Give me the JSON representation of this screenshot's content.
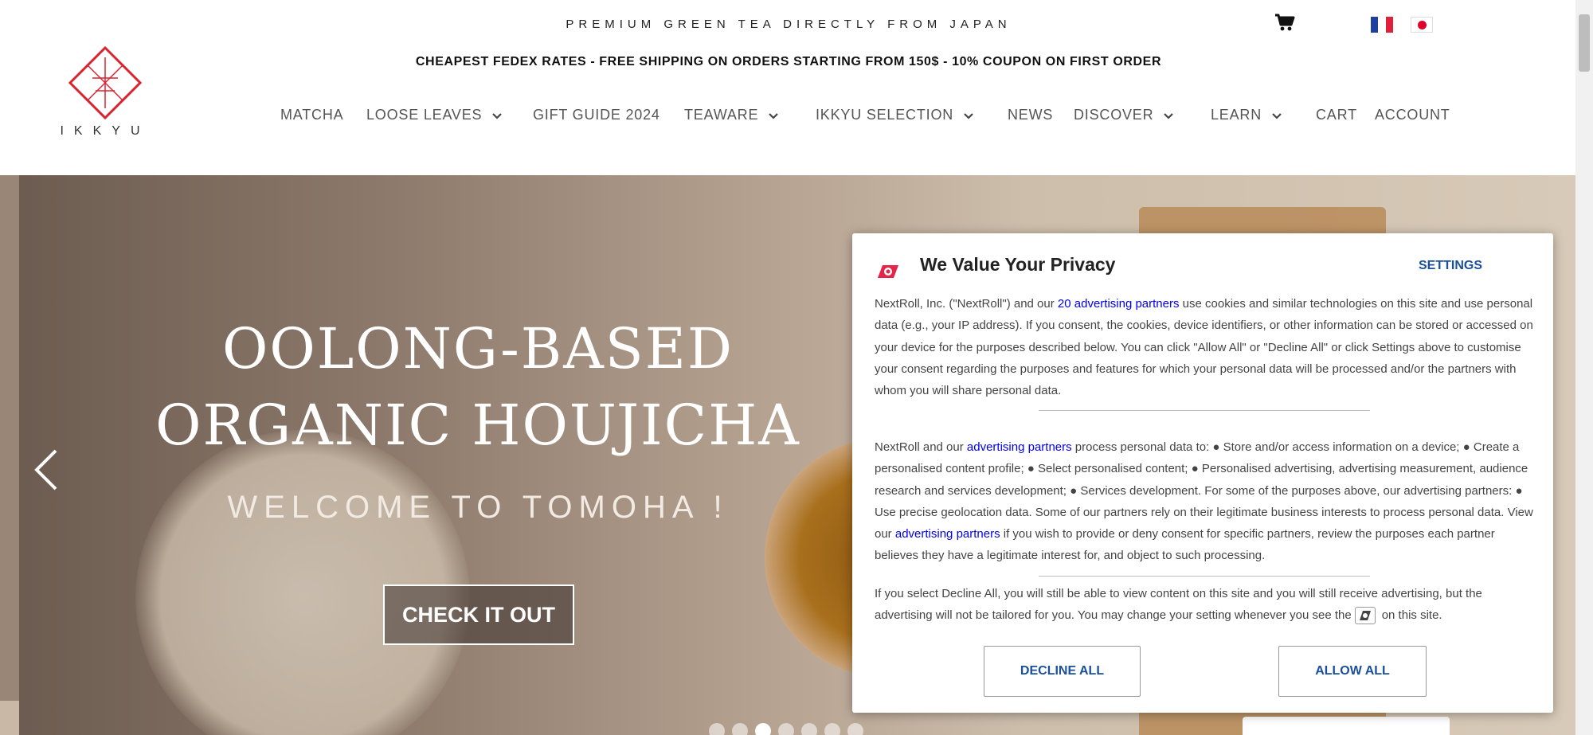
{
  "header": {
    "tagline": "PREMIUM GREEN TEA DIRECTLY FROM JAPAN",
    "shipping_banner": "CHEAPEST FEDEX RATES - FREE SHIPPING ON ORDERS STARTING FROM 150$ - 10% COUPON ON FIRST ORDER",
    "logo_text": "IKKYU",
    "icons": {
      "cart": "cart-icon",
      "flag_fr": "flag-france-icon",
      "flag_jp": "flag-japan-icon"
    }
  },
  "nav": {
    "items": [
      {
        "label": "MATCHA",
        "dropdown": false
      },
      {
        "label": "LOOSE LEAVES",
        "dropdown": true
      },
      {
        "label": "GIFT GUIDE 2024",
        "dropdown": false
      },
      {
        "label": "TEAWARE",
        "dropdown": true
      },
      {
        "label": "IKKYU SELECTION",
        "dropdown": true
      },
      {
        "label": "NEWS",
        "dropdown": false
      },
      {
        "label": "DISCOVER",
        "dropdown": true
      },
      {
        "label": "LEARN",
        "dropdown": true
      },
      {
        "label": "CART",
        "dropdown": false
      },
      {
        "label": "ACCOUNT",
        "dropdown": false
      }
    ]
  },
  "hero": {
    "title_line1": "OOLONG-BASED",
    "title_line2": "ORGANIC HOUJICHA",
    "subtitle": "WELCOME TO TOMOHA !",
    "button": "CHECK IT OUT",
    "slide_count": 7,
    "active_slide": 3
  },
  "consent": {
    "title": "We Value Your Privacy",
    "settings": "SETTINGS",
    "p1": {
      "before": "NextRoll, Inc. (\"NextRoll\") and our ",
      "link": "20 advertising partners",
      "after": " use cookies and similar technologies on this site and use personal data (e.g., your IP address). If you consent, the cookies, device identifiers, or other information can be stored or accessed on your device for the purposes described below. You can click \"Allow All\" or \"Decline All\" or click Settings above to customise your consent regarding the purposes and features for which your personal data will be processed and/or the partners with whom you will share personal data."
    },
    "p2": {
      "before": "NextRoll and our ",
      "link1": "advertising partners",
      "middle": " process personal data to: ● Store and/or access information on a device; ● Create a personalised content profile; ● Select personalised content; ● Personalised advertising, advertising measurement, audience research and services development; ● Services development. For some of the purposes above, our advertising partners: ● Use precise geolocation data. Some of our partners rely on their legitimate business interests to process personal data. View our ",
      "link2": "advertising partners",
      "after": " if you wish to provide or deny consent for specific partners, review the purposes each partner believes they have a legitimate interest for, and object to such processing."
    },
    "p3": {
      "before": "If you select Decline All, you will still be able to view content on this site and you will still receive advertising, but the advertising will not be tailored for you. You may change your setting whenever you see the",
      "after": "on this site."
    },
    "decline": "DECLINE ALL",
    "allow": "ALLOW ALL",
    "brand_color": "#e8234a"
  }
}
